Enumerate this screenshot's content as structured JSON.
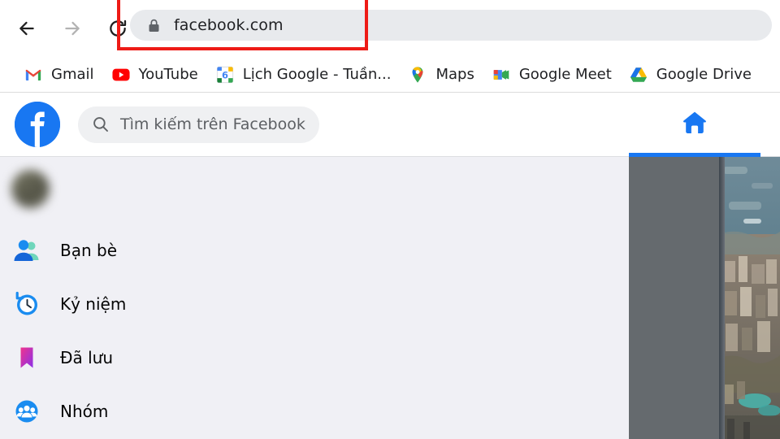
{
  "browser": {
    "nav": {
      "back_icon": "arrow-left-icon",
      "forward_icon": "arrow-right-icon",
      "reload_icon": "reload-icon"
    },
    "omnibox": {
      "url": "facebook.com",
      "lock_icon": "lock-icon",
      "secure": true
    },
    "annotation": {
      "type": "red-rectangle-highlight",
      "color": "#ee1b16",
      "target": "omnibox"
    },
    "bookmarks": [
      {
        "label": "Gmail",
        "icon": "gmail-icon"
      },
      {
        "label": "YouTube",
        "icon": "youtube-icon"
      },
      {
        "label": "Lịch Google - Tuần...",
        "icon": "google-calendar-icon",
        "badge": "6"
      },
      {
        "label": "Maps",
        "icon": "google-maps-icon"
      },
      {
        "label": "Google Meet",
        "icon": "google-meet-icon"
      },
      {
        "label": "Google Drive",
        "icon": "google-drive-icon"
      }
    ]
  },
  "facebook": {
    "logo_icon": "facebook-logo-icon",
    "brand_color": "#1877f2",
    "search": {
      "placeholder": "Tìm kiếm trên Facebook",
      "value": "",
      "icon": "search-icon"
    },
    "tabs": [
      {
        "name": "home",
        "icon": "home-icon",
        "active": true
      }
    ],
    "sidebar": {
      "profile": {
        "name": "",
        "blurred": true,
        "avatar_icon": "avatar"
      },
      "items": [
        {
          "label": "Bạn bè",
          "icon": "friends-icon"
        },
        {
          "label": "Kỷ niệm",
          "icon": "memories-clock-icon"
        },
        {
          "label": "Đã lưu",
          "icon": "saved-bookmark-icon"
        },
        {
          "label": "Nhóm",
          "icon": "groups-icon"
        }
      ]
    },
    "feed": {
      "panel_color": "#656a6e",
      "photo_alt": "aerial-cityscape-photo"
    }
  }
}
